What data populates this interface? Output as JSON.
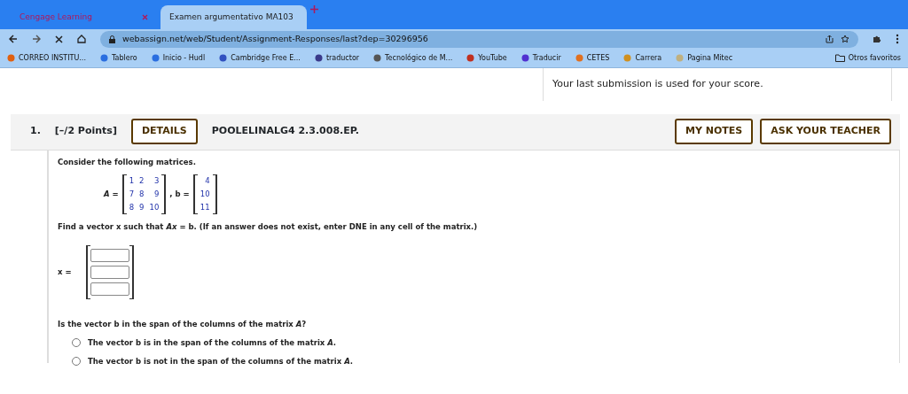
{
  "browser": {
    "tabs": [
      {
        "title": "Cengage Learning",
        "selected": false
      },
      {
        "title": "Examen argumentativo MA103",
        "selected": true
      }
    ],
    "url": "webassign.net/web/Student/Assignment-Responses/last?dep=30296956",
    "bookmarks": [
      "CORREO INSTITU...",
      "Tablero",
      "Inicio - Hudl",
      "Cambridge Free E...",
      "traductor",
      "Tecnológico de M...",
      "YouTube",
      "Traducir",
      "CETES",
      "Carrera",
      "Pagina Mitec"
    ],
    "other_bookmarks": "Otros favoritos"
  },
  "notice": "Your last submission is used for your score.",
  "question": {
    "number": "1.",
    "points": "[–/2 Points]",
    "details": "DETAILS",
    "code": "POOLELINALG4 2.3.008.EP.",
    "buttons": [
      "MY NOTES",
      "ASK YOUR TEACHER"
    ],
    "prompt": "Consider the following matrices.",
    "matrix_label": "*A* =",
    "matrix": [
      [
        "1",
        "2",
        "3"
      ],
      [
        "7",
        "8",
        "9"
      ],
      [
        "8",
        "9",
        "10"
      ]
    ],
    "vector_label": ", b =",
    "vector": [
      "4",
      "10",
      "11"
    ],
    "instruction": "Find a vector x such that *Ax* = b. (If an answer does not exist, enter DNE in any cell of the matrix.)",
    "answer_label": "x =",
    "answer_fields": [
      {
        "kind": "input"
      },
      {
        "kind": "input"
      },
      {
        "kind": "input"
      }
    ],
    "span_question": "Is the vector b in the span of the columns of the matrix *A*?",
    "options": [
      {
        "text": "The vector b is in the span of the columns of the matrix *A*.",
        "selected": false
      },
      {
        "text": "The vector b is not in the span of the columns of the matrix *A*.",
        "selected": false
      }
    ]
  }
}
